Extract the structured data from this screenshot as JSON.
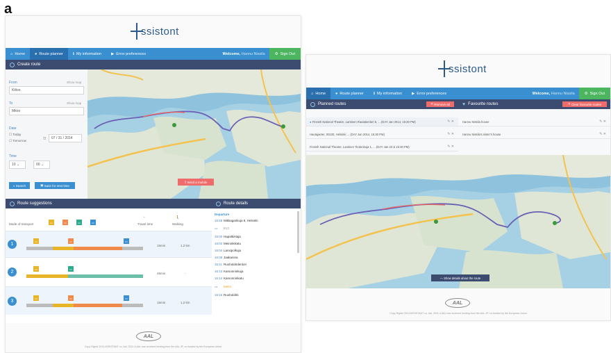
{
  "figure_label": "a",
  "logo_text": "ssistont",
  "screen1": {
    "nav": {
      "items": [
        {
          "label": "Home",
          "icon": "home-icon"
        },
        {
          "label": "Route planner",
          "icon": "pin-icon"
        },
        {
          "label": "My information",
          "icon": "info-icon"
        },
        {
          "label": "Error preferences",
          "icon": "flag-icon"
        }
      ],
      "welcome_label": "Welcome,",
      "welcome_user": "Hannu Nissila",
      "signout": "Sign Out"
    },
    "create_route": {
      "title": "Create route",
      "from_label": "From",
      "from_show_map": "Show map",
      "from_value": "Kiltoo",
      "to_label": "To",
      "to_show_map": "Show map",
      "to_value": "Mitoo",
      "date_label": "Date",
      "today": "Today",
      "tomorrow": "Tomorrow",
      "date_value": "07 / 31 / 2014",
      "time_label": "Time",
      "hour": "10",
      "minute": "00",
      "search_btn": "Search",
      "save_btn": "Save for next time",
      "send_btn": "Send a mobile"
    },
    "suggestions": {
      "title": "Route suggestions",
      "mode_label": "Mode of transport",
      "col_travel": "Travel time",
      "col_walking": "Walking",
      "rows": [
        {
          "num": "1",
          "time": "15min",
          "walk": "1,2 km"
        },
        {
          "num": "2",
          "time": "45min",
          "walk": "-"
        },
        {
          "num": "3",
          "time": "15min",
          "walk": "1,2 km"
        }
      ]
    },
    "details": {
      "title": "Route details",
      "departure": "Departure",
      "lines": [
        {
          "t": "15:58",
          "name": "Mikkagarikuja 8, Helsinki"
        },
        {
          "t": "",
          "name": "B13"
        },
        {
          "t": "16:00",
          "name": "Hapalkintaja"
        },
        {
          "t": "16:02",
          "name": "Meininkikatu"
        },
        {
          "t": "16:04",
          "name": "Lansipolkuja"
        },
        {
          "t": "16:06",
          "name": "Jaakanina"
        },
        {
          "t": "16:11",
          "name": "Ruoholahdentori"
        },
        {
          "t": "16:13",
          "name": "Kamonninkuja"
        },
        {
          "t": "16:14",
          "name": "Kamonninkatu"
        },
        {
          "t": "",
          "name": "Metro"
        },
        {
          "t": "16:16",
          "name": "Ruoholahti"
        }
      ]
    },
    "footer": "Copy Rights 2014 ASSISTANT co. Aal, 2011-4 AAL has received funding from the AAL JP, co-funded by the European Union"
  },
  "screen2": {
    "nav": {
      "items": [
        {
          "label": "Home",
          "icon": "home-icon"
        },
        {
          "label": "Route planner",
          "icon": "pin-icon"
        },
        {
          "label": "My information",
          "icon": "info-icon"
        },
        {
          "label": "Error preferences",
          "icon": "flag-icon"
        }
      ],
      "welcome_label": "Welcome,",
      "welcome_user": "Hannu Nissila",
      "signout": "Sign Out"
    },
    "planned": {
      "title": "Planned routes",
      "remove_all": "Remove all",
      "rows": [
        "Finnish National Theatre, Lantinen Rautatientori 5, ... (DAY Jan 2014, 15:30 PM)",
        "Hautajaeter, 00100, Helsinki ... (DAY Jan 2014, 15:30 PM)",
        "Finnish National Theatre, Lantinen Tiedonkuja 1, ... (DAY Jan 23 & 15:30 PM)"
      ]
    },
    "favourite": {
      "title": "Favourite routes",
      "clear_btn": "Clear favourite routes",
      "rows": [
        "Hannu Nissila house",
        "Hannu Nissila's sister's house"
      ]
    },
    "map_btn": "Show details about the route",
    "footer": "Copy Rights 2014 ASSISTANT co. Aal, 2011-4 AAL has received funding from the AAL JP, co-funded by the European Union"
  },
  "colors": {
    "nav_blue": "#3a8fd0",
    "dark_bar": "#3c4c70",
    "signout_green": "#4cb560",
    "alert_red": "#ef6c6c",
    "route_purple": "#6b5fb5",
    "bus_orange": "#f08a4b",
    "tram_yellow": "#e8b42a",
    "metro_teal": "#2eab8e"
  },
  "aal_logo": "AAL"
}
